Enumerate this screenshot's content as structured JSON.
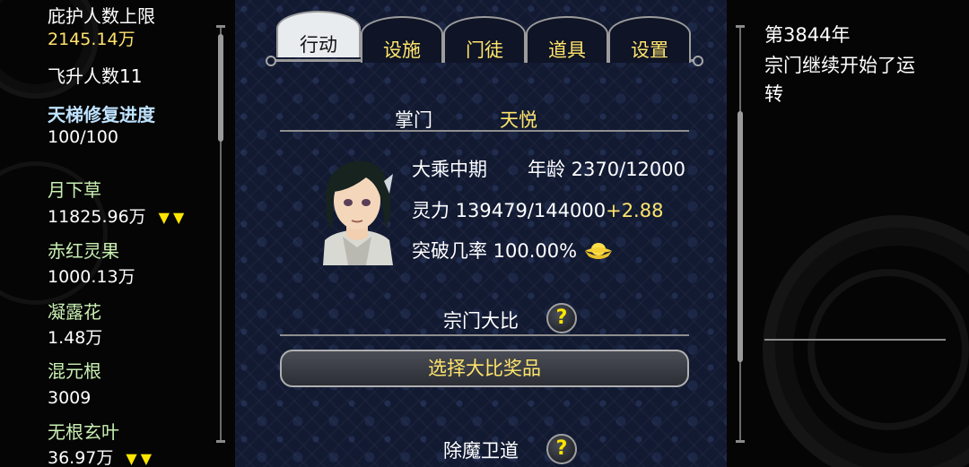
{
  "left_panel": {
    "protect_label": "庇护人数上限",
    "protect_value": "2145.14万",
    "ascend_label": "飞升人数11",
    "ladder_label": "天梯修复进度",
    "ladder_value": "100/100",
    "resources": [
      {
        "name": "月下草",
        "value": "11825.96万",
        "trend": "▼▼"
      },
      {
        "name": "赤红灵果",
        "value": "1000.13万",
        "trend": ""
      },
      {
        "name": "凝露花",
        "value": "1.48万",
        "trend": ""
      },
      {
        "name": "混元根",
        "value": "3009",
        "trend": ""
      },
      {
        "name": "无根玄叶",
        "value": "36.97万",
        "trend": "▼▼"
      }
    ]
  },
  "tabs": [
    {
      "label": "行动",
      "active": true
    },
    {
      "label": "设施",
      "active": false
    },
    {
      "label": "门徒",
      "active": false
    },
    {
      "label": "道具",
      "active": false
    },
    {
      "label": "设置",
      "active": false
    }
  ],
  "leader": {
    "title_label": "掌门",
    "name": "天悦",
    "realm": "大乘中期",
    "age_text": "年龄 2370/12000",
    "spirit_text": "灵力 139479/144000",
    "spirit_bonus": "+2.88",
    "breakthrough_text": "突破几率 100.00%"
  },
  "sections": {
    "tournament_label": "宗门大比",
    "tournament_help": "?",
    "reward_button": "选择大比奖品",
    "demon_guard_label": "除魔卫道",
    "demon_guard_help": "?"
  },
  "log": {
    "year": "第3844年",
    "line1": "宗门继续开始了运",
    "line2": "转"
  },
  "colors": {
    "accent_yellow": "#ffe56c",
    "resource_green": "#c9f0b3",
    "progress_blue": "#bfe3ff",
    "center_bg": "#121a32"
  }
}
